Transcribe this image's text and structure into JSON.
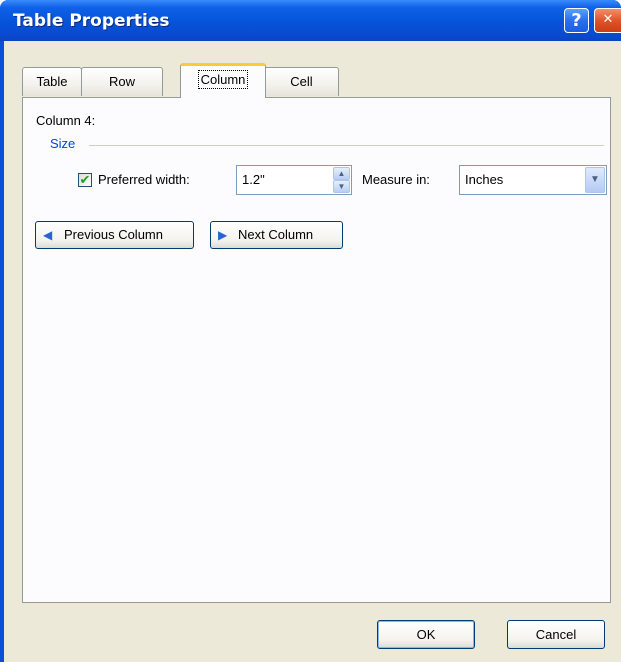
{
  "window": {
    "title": "Table Properties",
    "help_label": "?",
    "close_label": "✕"
  },
  "tabs": [
    {
      "label": "Table"
    },
    {
      "label": "Row"
    },
    {
      "label": "Column"
    },
    {
      "label": "Cell"
    }
  ],
  "active_tab": "Column",
  "column_panel": {
    "column_label": "Column 4:",
    "size_group_label": "Size",
    "preferred_width_checked": true,
    "check_mark": "✔",
    "preferred_width_label": "Preferred width:",
    "preferred_width_value": "1.2\"",
    "measure_in_label": "Measure in:",
    "measure_in_value": "Inches",
    "previous_column_label": "Previous Column",
    "next_column_label": "Next Column"
  },
  "footer": {
    "ok_label": "OK",
    "cancel_label": "Cancel"
  },
  "icons": {
    "help": "question-mark-icon",
    "close": "close-icon",
    "prev": "arrow-left-icon",
    "next": "arrow-right-icon",
    "spin_up": "triangle-up-icon",
    "spin_down": "triangle-down-icon",
    "dropdown": "chevron-down-icon",
    "spin_up_glyph": "▲",
    "spin_down_glyph": "▼",
    "dropdown_glyph": "▼",
    "prev_glyph": "◀",
    "next_glyph": "▶"
  },
  "colors": {
    "title_bar": "#0553d8",
    "dialog_bg": "#ece9d8",
    "panel_bg": "#fcfcfe",
    "group_label": "#0046d5",
    "active_tab_accent": "#ffc83c",
    "check_color": "#21a121",
    "close_button": "#e0542a"
  }
}
